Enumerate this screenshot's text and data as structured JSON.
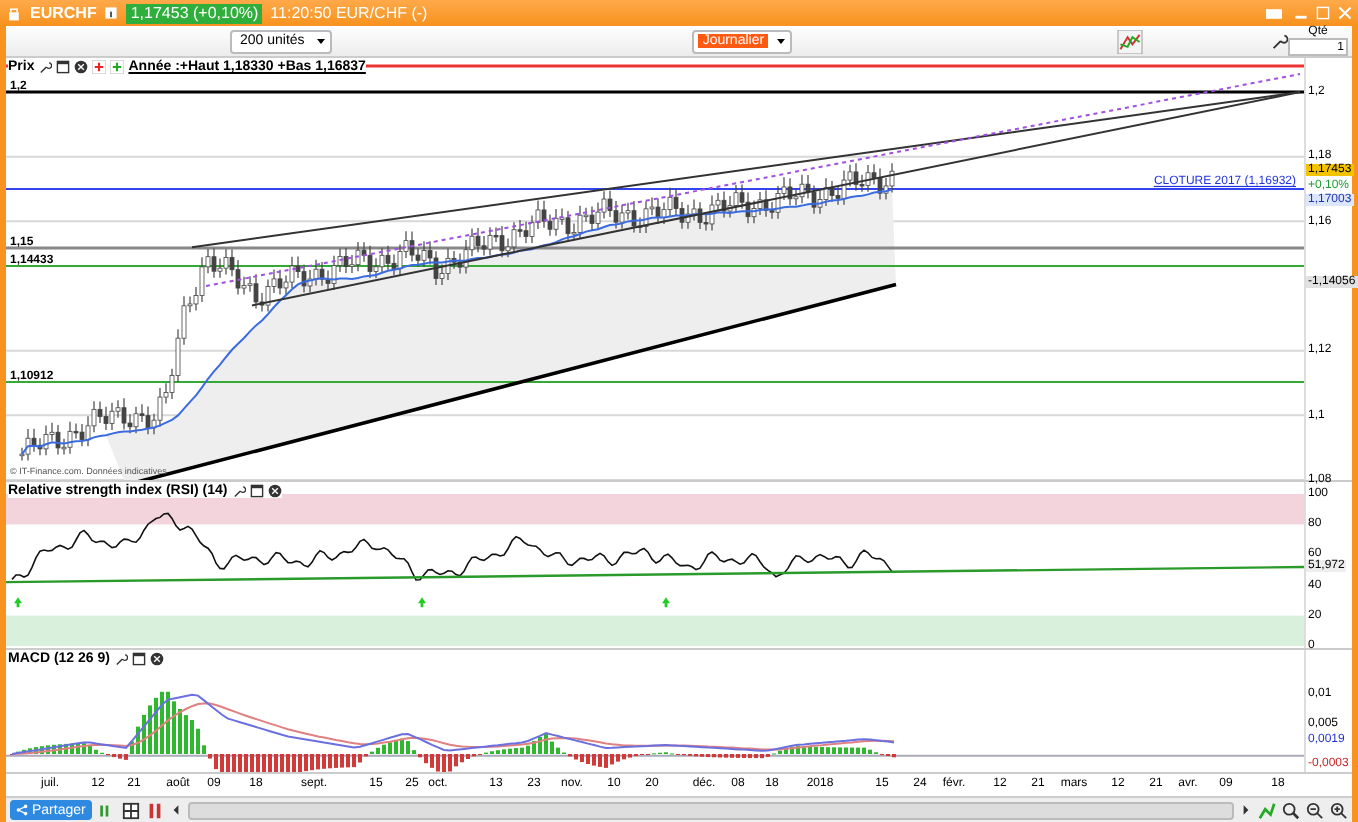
{
  "title_bar": {
    "symbol": "EURCHF",
    "price": "1,17453 (+0,10%)",
    "time": "11:20:50 EUR/CHF (-)"
  },
  "toolbar": {
    "units": "200 unités",
    "period": "Journalier",
    "qty_label": "Qté",
    "qty": "1"
  },
  "price_panel": {
    "label": "Prix",
    "legend": "Année :+Haut 1,18330 +Bas 1,16837",
    "credit": "© IT-Finance.com. Données indicatives",
    "closing_note": "CLOTURE 2017 (1,16932)",
    "level_labels": [
      {
        "text": "1,2"
      },
      {
        "text": "1,15"
      },
      {
        "text": "1,14433"
      },
      {
        "text": "1,10912"
      }
    ],
    "yticks": [
      "1,2",
      "1,18",
      "1,16",
      "1,12",
      "1,1",
      "1,08"
    ],
    "tags": [
      {
        "text": "1,17453",
        "kind": "last"
      },
      {
        "text": "+0,10%",
        "kind": "change"
      },
      {
        "text": "1,17003",
        "kind": "average"
      },
      {
        "text": "-1,14056",
        "kind": "trend"
      }
    ]
  },
  "rsi_panel": {
    "label": "Relative strength index (RSI) (14)",
    "yticks": [
      "100",
      "80",
      "60",
      "40",
      "20",
      "0"
    ],
    "value": "51,972"
  },
  "macd_panel": {
    "label": "MACD (12 26 9)",
    "yticks": [
      "0,01",
      "0,005"
    ],
    "tags": [
      {
        "text": "0,0019",
        "kind": "macd"
      },
      {
        "text": "-0,0003",
        "kind": "histogram"
      }
    ]
  },
  "x_axis": [
    "juil.",
    "12",
    "21",
    "août",
    "09",
    "18",
    "sept.",
    "15",
    "25",
    "oct.",
    "13",
    "23",
    "nov.",
    "10",
    "20",
    "déc.",
    "08",
    "18",
    "2018",
    "15",
    "24",
    "févr.",
    "12",
    "21",
    "mars",
    "12",
    "21",
    "avr.",
    "09",
    "18"
  ],
  "bottom_bar": {
    "share": "Partager"
  }
}
